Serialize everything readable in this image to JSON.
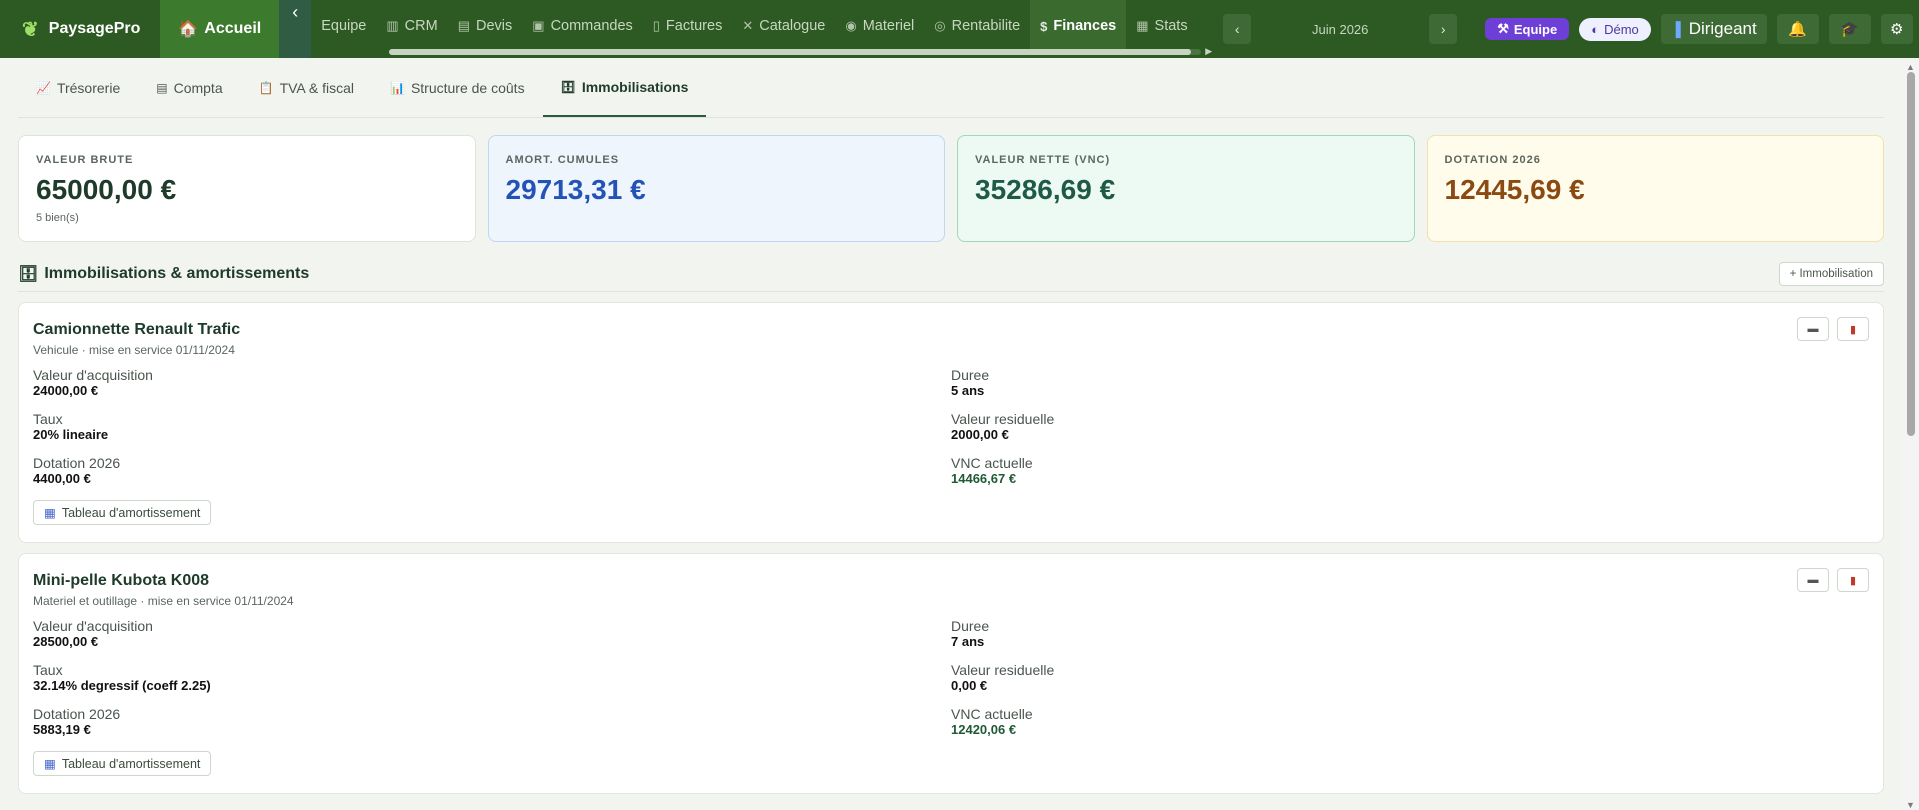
{
  "topbar": {
    "brand": "PaysagePro",
    "home": "Accueil",
    "nav": [
      {
        "label": "Equipe",
        "icon": "people-icon"
      },
      {
        "label": "CRM",
        "icon": "building-icon"
      },
      {
        "label": "Devis",
        "icon": "document-icon"
      },
      {
        "label": "Commandes",
        "icon": "package-icon"
      },
      {
        "label": "Factures",
        "icon": "receipt-icon"
      },
      {
        "label": "Catalogue",
        "icon": "tools-icon"
      },
      {
        "label": "Materiel",
        "icon": "tractor-icon"
      },
      {
        "label": "Rentabilite",
        "icon": "target-icon"
      },
      {
        "label": "Finances",
        "icon": "money-bag-icon",
        "active": true
      },
      {
        "label": "Stats",
        "icon": "bar-chart-icon"
      }
    ],
    "month": "Juin 2026",
    "team_pill": "Equipe",
    "demo_pill": "Démo",
    "role": "Dirigeant"
  },
  "tabs": [
    {
      "label": "Trésorerie",
      "icon": "chart-icon"
    },
    {
      "label": "Compta",
      "icon": "ledger-icon"
    },
    {
      "label": "TVA & fiscal",
      "icon": "clipboard-icon"
    },
    {
      "label": "Structure de coûts",
      "icon": "bar-chart-icon"
    },
    {
      "label": "Immobilisations",
      "icon": "cabinet-icon",
      "active": true
    }
  ],
  "kpis": {
    "brut": {
      "label": "VALEUR BRUTE",
      "value": "65000,00 €",
      "sub": "5 bien(s)"
    },
    "amort": {
      "label": "AMORT. CUMULES",
      "value": "29713,31 €"
    },
    "vnc": {
      "label": "VALEUR NETTE (VNC)",
      "value": "35286,69 €"
    },
    "dotation": {
      "label": "DOTATION 2026",
      "value": "12445,69 €"
    }
  },
  "colors": {
    "brut": "#1e3a2a",
    "amort": "#2453b8",
    "vnc": "#1f5a48",
    "dotation": "#8a4a12"
  },
  "section": {
    "title": "Immobilisations & amortissements",
    "add": "+ Immobilisation"
  },
  "labels": {
    "acquisition": "Valeur d'acquisition",
    "duree": "Duree",
    "taux": "Taux",
    "residuelle": "Valeur residuelle",
    "dotation": "Dotation 2026",
    "vnc": "VNC actuelle",
    "table_btn": "Tableau d'amortissement"
  },
  "assets": [
    {
      "name": "Camionnette Renault Trafic",
      "meta": "Vehicule · mise en service 01/11/2024",
      "acquisition": "24000,00 €",
      "duree": "5 ans",
      "taux": "20% lineaire",
      "residuelle": "2000,00 €",
      "dotation": "4400,00 €",
      "vnc": "14466,67 €"
    },
    {
      "name": "Mini-pelle Kubota K008",
      "meta": "Materiel et outillage · mise en service 01/11/2024",
      "acquisition": "28500,00 €",
      "duree": "7 ans",
      "taux": "32.14% degressif (coeff 2.25)",
      "residuelle": "0,00 €",
      "dotation": "5883,19 €",
      "vnc": "12420,06 €"
    }
  ]
}
